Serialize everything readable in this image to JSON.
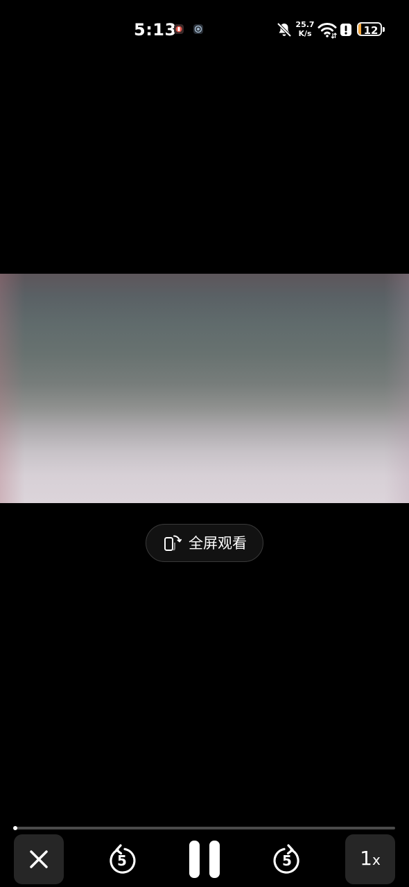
{
  "status_bar": {
    "time": "5:13",
    "net_speed_value": "25.7",
    "net_speed_unit": "K/s",
    "battery_level": "12",
    "battery_fraction": 0.12,
    "battery_color": "#f2a53a",
    "icons": [
      "app-notification-icon",
      "camera-notification-icon",
      "bell-off-icon",
      "wifi-icon",
      "alert-icon",
      "battery-icon"
    ]
  },
  "video": {
    "fullscreen_label": "全屏观看"
  },
  "player": {
    "progress_fraction": 0.003,
    "rewind_seconds": "5",
    "forward_seconds": "5",
    "speed_value": "1",
    "speed_unit": "x"
  }
}
